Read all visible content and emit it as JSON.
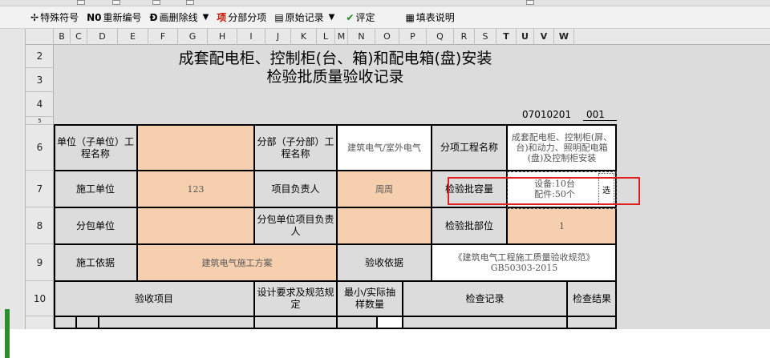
{
  "toolbar": {
    "buttons": [
      {
        "label": "特殊符号",
        "icon": "special-symbol-icon",
        "glyph": "✢",
        "dropdown": false
      },
      {
        "label": "重新编号",
        "icon": "renumber-icon",
        "glyph": "N0",
        "dropdown": false
      },
      {
        "label": "画删除线",
        "icon": "strikethrough-icon",
        "glyph": "Ɖ",
        "dropdown": true
      },
      {
        "label": "分部分项",
        "icon": "subdivision-icon",
        "glyph": "项",
        "dropdown": false
      },
      {
        "label": "原始记录",
        "icon": "original-record-icon",
        "glyph": "▤",
        "dropdown": true
      },
      {
        "label": "评定",
        "icon": "evaluate-icon",
        "glyph": "✔",
        "dropdown": false
      },
      {
        "label": "填表说明",
        "icon": "form-instructions-icon",
        "glyph": "▦",
        "dropdown": false
      }
    ]
  },
  "columns": [
    "B",
    "C",
    "D",
    "E",
    "F",
    "G",
    "H",
    "I",
    "J",
    "K",
    "L",
    "M",
    "N",
    "O",
    "P",
    "Q",
    "R",
    "S",
    "T",
    "U",
    "V",
    "W"
  ],
  "rows": [
    "2",
    "3",
    "4",
    "5",
    "6",
    "7",
    "8",
    "9",
    "10"
  ],
  "sheet": {
    "title_line1": "成套配电柜、控制柜(台、箱)和配电箱(盘)安装",
    "title_line2": "检验批质量验收记录",
    "code_left": "07010201",
    "code_right": "001",
    "labels": {
      "unit": "单位（子单位）工程名称",
      "division": "分部（子分部）工程名称",
      "subitem": "分项工程名称",
      "constructor": "施工单位",
      "project_manager": "项目负责人",
      "batch_capacity": "检验批容量",
      "subcontractor": "分包单位",
      "sub_manager": "分包单位项目负责人",
      "batch_location": "检验批部位",
      "basis": "施工依据",
      "acceptance_basis": "验收依据",
      "acceptance_item": "验收项目",
      "design_req": "设计要求及规范规定",
      "sampling": "最小/实际抽样数量",
      "check_record": "检查记录",
      "check_result": "检查结果"
    },
    "values": {
      "unit": "",
      "division": "建筑电气/室外电气",
      "subitem": "成套配电柜、控制柜(屏、台)和动力、照明配电箱(盘)及控制柜安装",
      "constructor": "123",
      "project_manager": "周周",
      "batch_capacity_1": "设备:10台",
      "batch_capacity_2": "配件:50个",
      "subcontractor": "",
      "sub_manager": "",
      "batch_location": "1",
      "basis": "建筑电气施工方案",
      "acceptance_basis": "《建筑电气工程施工质量验收规范》GB50303-2015"
    },
    "pick_label": "选"
  }
}
